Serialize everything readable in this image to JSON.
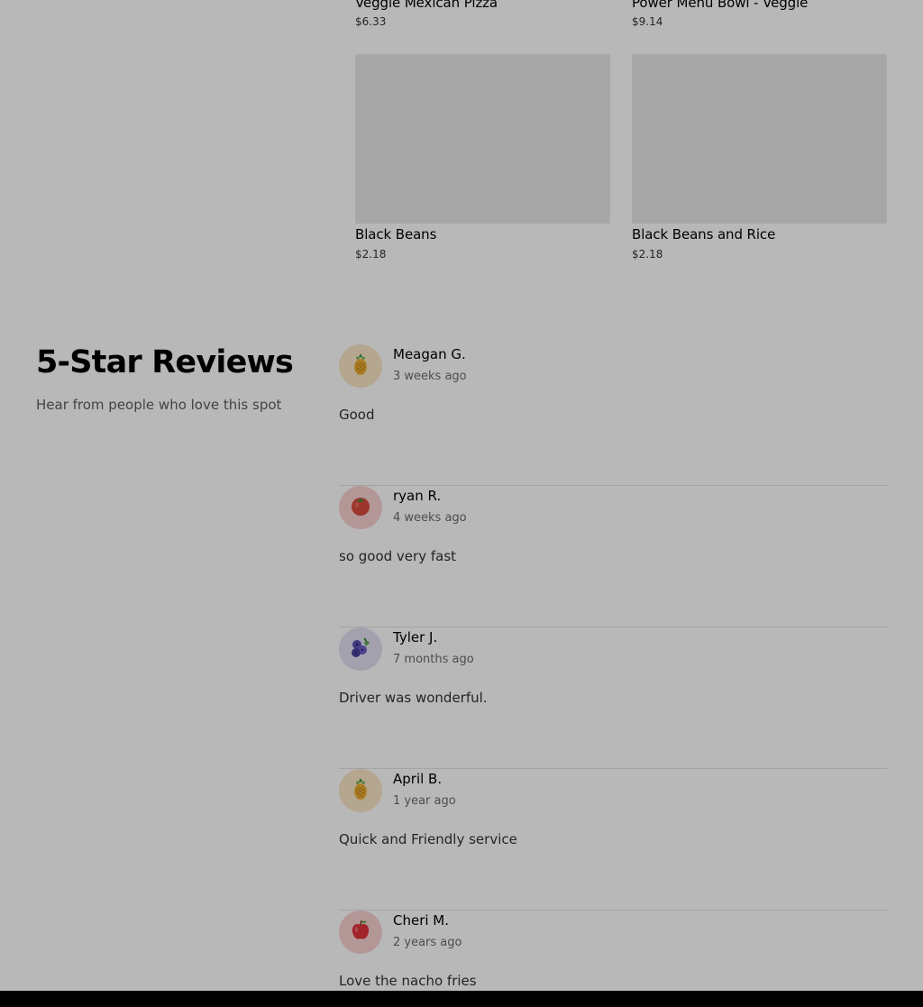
{
  "menu": {
    "items": [
      {
        "name": "Veggie Mexican Pizza",
        "price": "$6.33"
      },
      {
        "name": "Power Menu Bowl - Veggie",
        "price": "$9.14"
      },
      {
        "name": "Black Beans",
        "price": "$2.18"
      },
      {
        "name": "Black Beans and Rice",
        "price": "$2.18"
      }
    ]
  },
  "reviews": {
    "title": "5-Star Reviews",
    "subtitle": "Hear from people who love this spot",
    "list": [
      {
        "name": "Meagan G.",
        "time": "3 weeks ago",
        "text": "Good",
        "avatar_icon": "pineapple-icon",
        "avatar_bg": "#fbe7c6"
      },
      {
        "name": "ryan R.",
        "time": "4 weeks ago",
        "text": "so good very fast",
        "avatar_icon": "tomato-icon",
        "avatar_bg": "#f9d1d0"
      },
      {
        "name": "Tyler J.",
        "time": "7 months ago",
        "text": "Driver was wonderful.",
        "avatar_icon": "blueberries-icon",
        "avatar_bg": "#e3dff2"
      },
      {
        "name": "April B.",
        "time": "1 year ago",
        "text": "Quick and Friendly service",
        "avatar_icon": "pineapple-icon",
        "avatar_bg": "#fbe7c6"
      },
      {
        "name": "Cheri M.",
        "time": "2 years ago",
        "text": "Love the nacho fries",
        "avatar_icon": "apple-icon",
        "avatar_bg": "#f9d1d0"
      }
    ]
  }
}
